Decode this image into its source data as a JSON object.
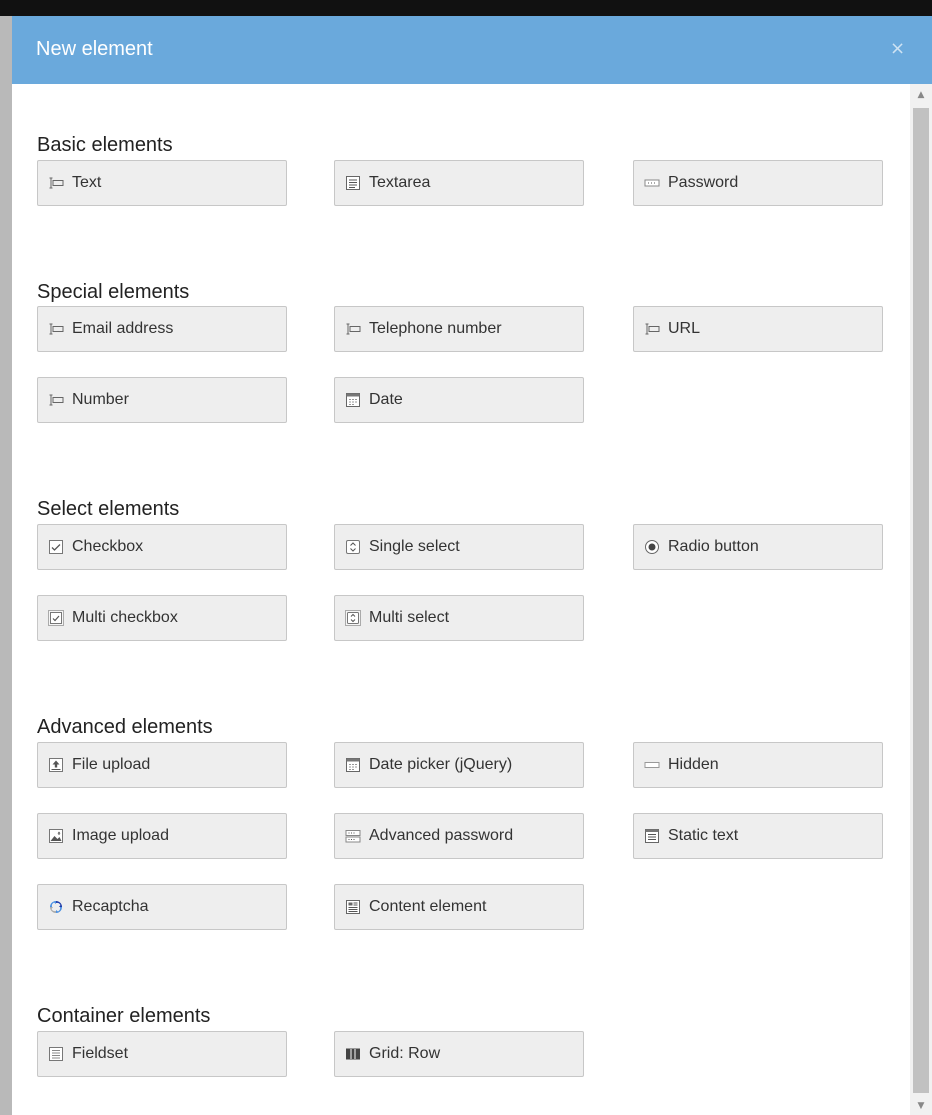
{
  "modal": {
    "title": "New element",
    "close": "×"
  },
  "sections": {
    "basic": {
      "title": "Basic elements",
      "items": [
        {
          "label": "Text",
          "icon": "text-field-icon"
        },
        {
          "label": "Textarea",
          "icon": "textarea-icon"
        },
        {
          "label": "Password",
          "icon": "password-icon"
        }
      ]
    },
    "special": {
      "title": "Special elements",
      "items": [
        {
          "label": "Email address",
          "icon": "text-field-icon"
        },
        {
          "label": "Telephone number",
          "icon": "text-field-icon"
        },
        {
          "label": "URL",
          "icon": "text-field-icon"
        },
        {
          "label": "Number",
          "icon": "text-field-icon"
        },
        {
          "label": "Date",
          "icon": "calendar-icon"
        }
      ]
    },
    "select": {
      "title": "Select elements",
      "items": [
        {
          "label": "Checkbox",
          "icon": "checkbox-icon"
        },
        {
          "label": "Single select",
          "icon": "select-icon"
        },
        {
          "label": "Radio button",
          "icon": "radio-icon"
        },
        {
          "label": "Multi checkbox",
          "icon": "multi-checkbox-icon"
        },
        {
          "label": "Multi select",
          "icon": "multi-select-icon"
        }
      ]
    },
    "advanced": {
      "title": "Advanced elements",
      "items": [
        {
          "label": "File upload",
          "icon": "file-upload-icon"
        },
        {
          "label": "Date picker (jQuery)",
          "icon": "calendar-icon"
        },
        {
          "label": "Hidden",
          "icon": "hidden-field-icon"
        },
        {
          "label": "Image upload",
          "icon": "image-upload-icon"
        },
        {
          "label": "Advanced password",
          "icon": "advanced-password-icon"
        },
        {
          "label": "Static text",
          "icon": "static-text-icon"
        },
        {
          "label": "Recaptcha",
          "icon": "recaptcha-icon"
        },
        {
          "label": "Content element",
          "icon": "content-element-icon"
        }
      ]
    },
    "container": {
      "title": "Container elements",
      "items": [
        {
          "label": "Fieldset",
          "icon": "fieldset-icon"
        },
        {
          "label": "Grid: Row",
          "icon": "grid-row-icon"
        }
      ]
    }
  },
  "colors": {
    "header": "#6aa9dc",
    "button_bg": "#eeeeee",
    "button_border": "#c7c7c7"
  }
}
